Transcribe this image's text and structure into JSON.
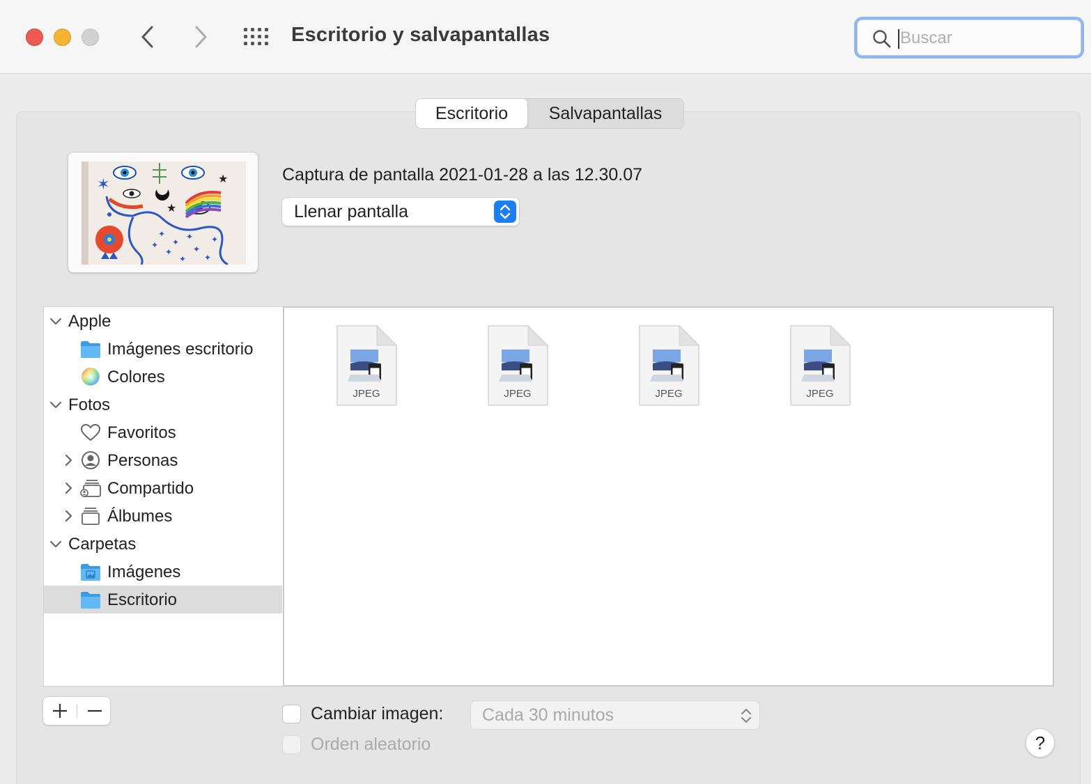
{
  "window": {
    "title": "Escritorio y salvapantallas",
    "search_placeholder": "Buscar"
  },
  "tabs": [
    {
      "label": "Escritorio",
      "active": true
    },
    {
      "label": "Salvapantallas",
      "active": false
    }
  ],
  "current": {
    "image_name": "Captura de pantalla 2021-01-28 a las 12.30.07",
    "fill_mode": "Llenar pantalla"
  },
  "sidebar": {
    "groups": [
      {
        "label": "Apple",
        "items": [
          {
            "label": "Imágenes escritorio",
            "icon": "folder-icon"
          },
          {
            "label": "Colores",
            "icon": "color-wheel-icon"
          }
        ]
      },
      {
        "label": "Fotos",
        "items": [
          {
            "label": "Favoritos",
            "icon": "heart-icon"
          },
          {
            "label": "Personas",
            "icon": "person-icon"
          },
          {
            "label": "Compartido",
            "icon": "shared-album-icon"
          },
          {
            "label": "Álbumes",
            "icon": "albums-icon"
          }
        ]
      },
      {
        "label": "Carpetas",
        "items": [
          {
            "label": "Imágenes",
            "icon": "pictures-folder-icon"
          },
          {
            "label": "Escritorio",
            "icon": "folder-icon",
            "selected": true
          }
        ]
      }
    ]
  },
  "files": [
    {
      "type": "JPEG"
    },
    {
      "type": "JPEG"
    },
    {
      "type": "JPEG"
    },
    {
      "type": "JPEG"
    }
  ],
  "bottom": {
    "change_picture_label": "Cambiar imagen:",
    "interval": "Cada 30 minutos",
    "random_order_label": "Orden aleatorio",
    "help": "?"
  },
  "colors": {
    "accent": "#1a7ff6",
    "search_focus": "#8fb7ee",
    "close": "#ee5a52",
    "minimize": "#f5b332"
  }
}
